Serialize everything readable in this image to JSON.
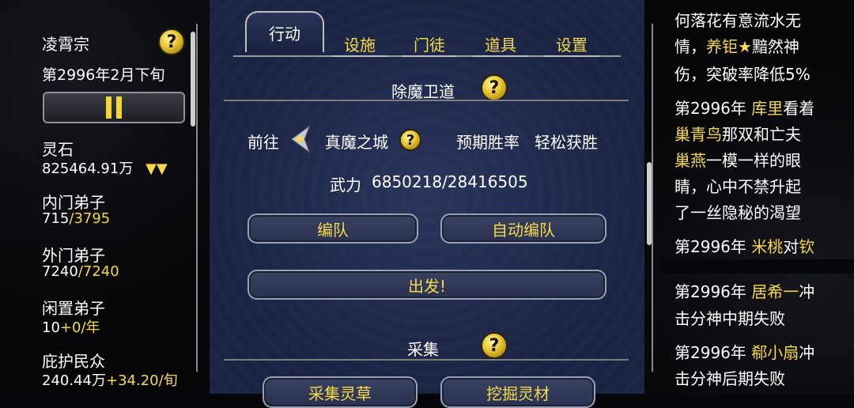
{
  "sidebar": {
    "sect_name": "凌霄宗",
    "date": "第2996年2月下旬",
    "stats": {
      "spirit_stone_label": "灵石",
      "spirit_stone_value": "825464.91万",
      "spirit_stone_trend": "▼▼",
      "inner_label": "内门弟子",
      "inner_current": "715",
      "inner_sep": "/",
      "inner_max": "3795",
      "outer_label": "外门弟子",
      "outer_current": "7240",
      "outer_sep": "/",
      "outer_max": "7240",
      "idle_label": "闲置弟子",
      "idle_value": "10",
      "idle_rate": "+0/年",
      "protect_label": "庇护民众",
      "protect_value": "240.44万",
      "protect_rate": "+34.20/旬"
    }
  },
  "tabs": {
    "active": "行动",
    "items": [
      "设施",
      "门徒",
      "道具",
      "设置"
    ]
  },
  "main": {
    "section1_title": "除魔卫道",
    "goto_label": "前往",
    "destination": "真魔之城",
    "win_rate_label": "预期胜率",
    "win_rate_value": "轻松获胜",
    "power_label": "武力",
    "power_value": "6850218/28416505",
    "formation_button": "编队",
    "auto_formation_button": "自动编队",
    "depart_button": "出发!",
    "section2_title": "采集",
    "gather_herb_button": "采集灵草",
    "dig_material_button": "挖掘灵材"
  },
  "log": {
    "entry1": [
      "何落花有意流水无",
      "情，",
      "养钜",
      "★",
      "黯然神",
      "伤，突破率降低5%"
    ],
    "entry2": [
      "第2996年 ",
      "库里",
      "看着",
      "巢青鸟",
      "那双和亡夫",
      "巢燕",
      "一模一样的眼",
      "睛，心中不禁升起",
      "了一丝隐秘的渴望"
    ],
    "entry3": [
      "第2996年 ",
      "米桃",
      "对",
      "钦"
    ],
    "entry4": [
      "第2996年 ",
      "居希一",
      "冲",
      "击分神中期失败"
    ],
    "entry5": [
      "第2996年 ",
      "郗小扇",
      "冲",
      "击分神后期失败"
    ]
  },
  "icons": {
    "help": "question-icon",
    "pause": "pause-icon",
    "arrow": "left-arrow-icon",
    "star": "star-icon"
  },
  "colors": {
    "accent_yellow": "#f5d94a",
    "accent_cyan": "#5ad2ff",
    "panel_blue": "#1b2241"
  }
}
